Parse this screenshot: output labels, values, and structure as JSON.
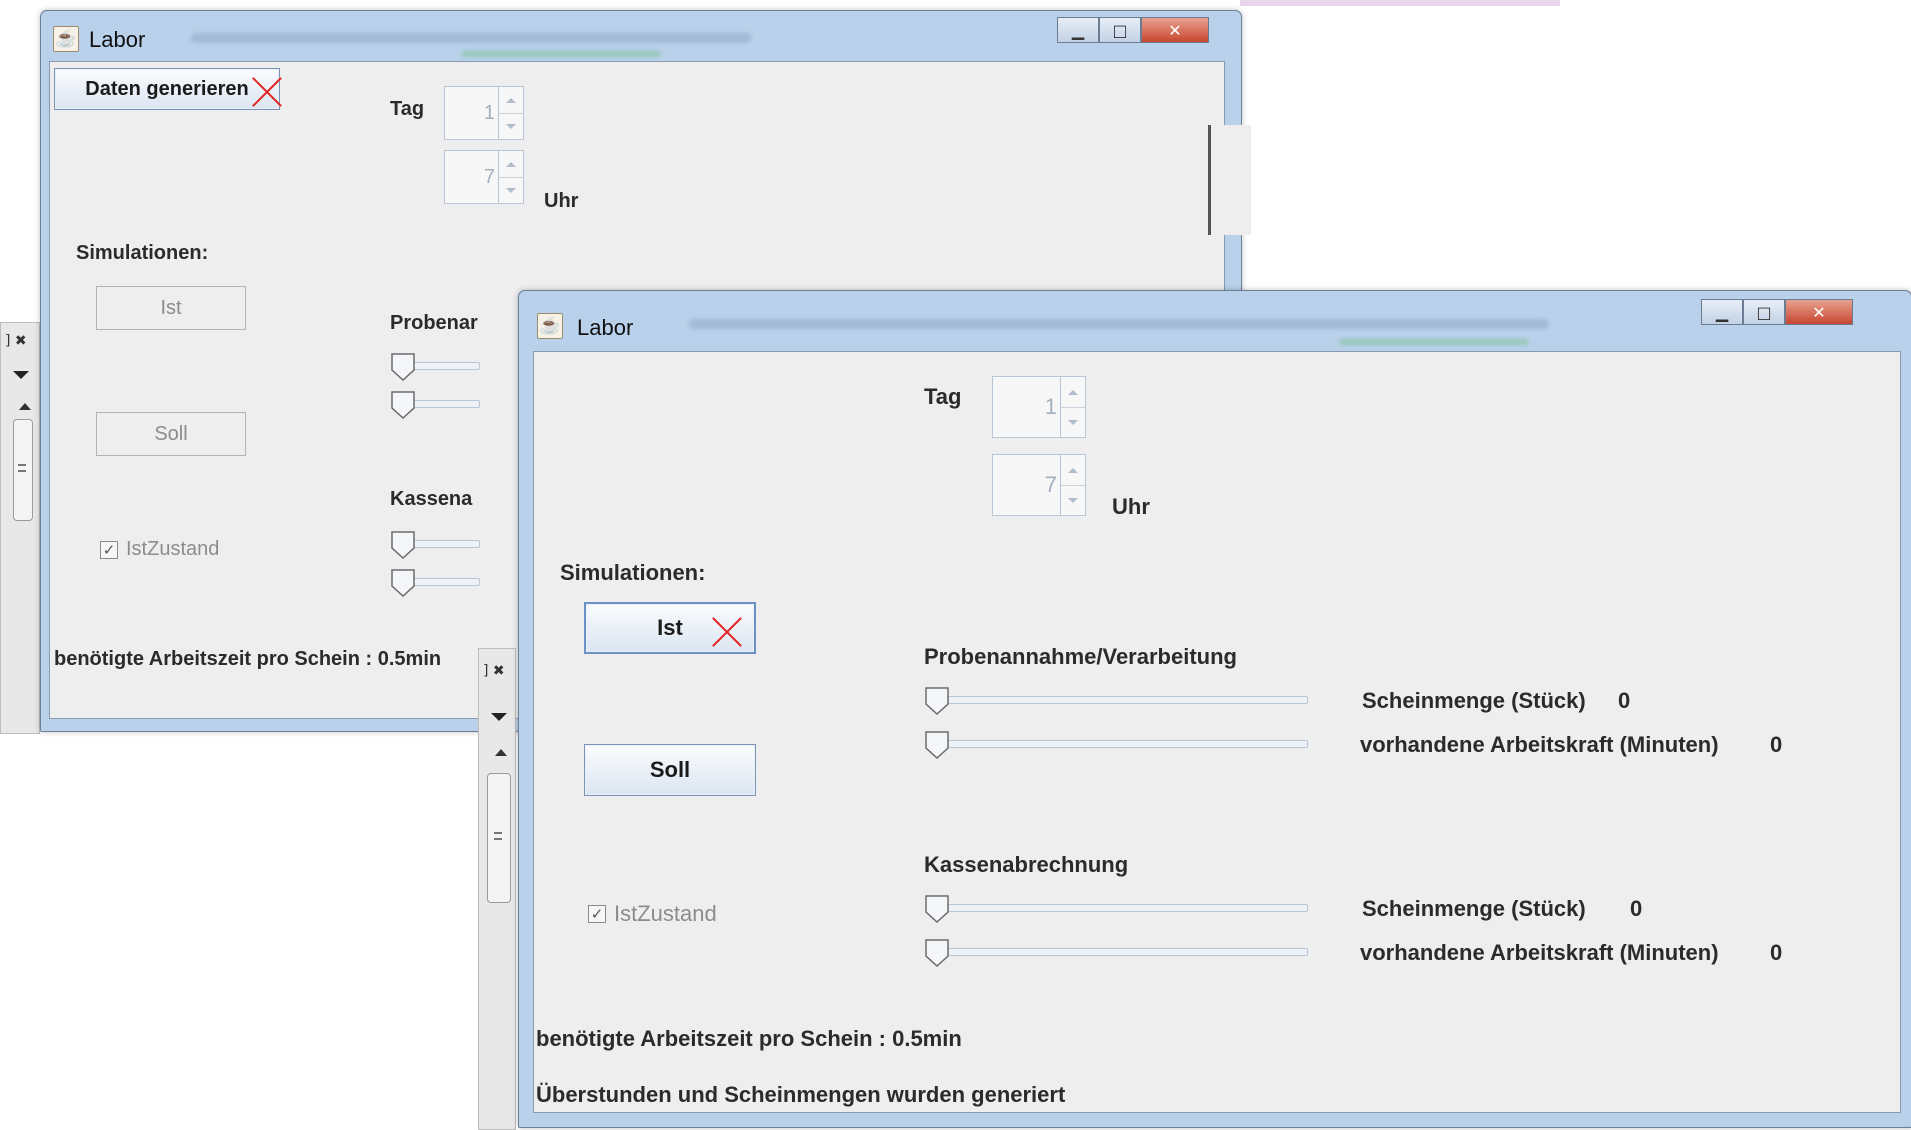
{
  "back_window": {
    "title": "Labor",
    "generate_button": "Daten generieren",
    "tag_label": "Tag",
    "tag_value": "1",
    "uhr_label": "Uhr",
    "uhr_value": "7",
    "simulations_label": "Simulationen:",
    "ist_button": "Ist",
    "soll_button": "Soll",
    "probe_label": "Probenar",
    "kasse_label": "Kassena",
    "istzustand_label": "IstZustand",
    "istzustand_checked": true,
    "worktime_text": "benötigte Arbeitszeit pro Schein : 0.5min"
  },
  "front_window": {
    "title": "Labor",
    "tag_label": "Tag",
    "tag_value": "1",
    "uhr_label": "Uhr",
    "uhr_value": "7",
    "simulations_label": "Simulationen:",
    "ist_button": "Ist",
    "soll_button": "Soll",
    "istzustand_label": "IstZustand",
    "istzustand_checked": true,
    "probe_section": {
      "title": "Probenannahme/Verarbeitung",
      "scheinmenge_label": "Scheinmenge (Stück)",
      "scheinmenge_value": "0",
      "arbeitskraft_label": "vorhandene Arbeitskraft (Minuten)",
      "arbeitskraft_value": "0"
    },
    "kasse_section": {
      "title": "Kassenabrechnung",
      "scheinmenge_label": "Scheinmenge (Stück)",
      "scheinmenge_value": "0",
      "arbeitskraft_label": "vorhandene Arbeitskraft (Minuten)",
      "arbeitskraft_value": "0"
    },
    "worktime_text": "benötigte Arbeitszeit pro Schein : 0.5min",
    "status_text": "Überstunden und Scheinmengen wurden generiert"
  },
  "colors": {
    "window_frame": "#b9d1ea",
    "content_bg": "#eeeeee",
    "close_button": "#c84630",
    "red_cross": "#e02525"
  }
}
